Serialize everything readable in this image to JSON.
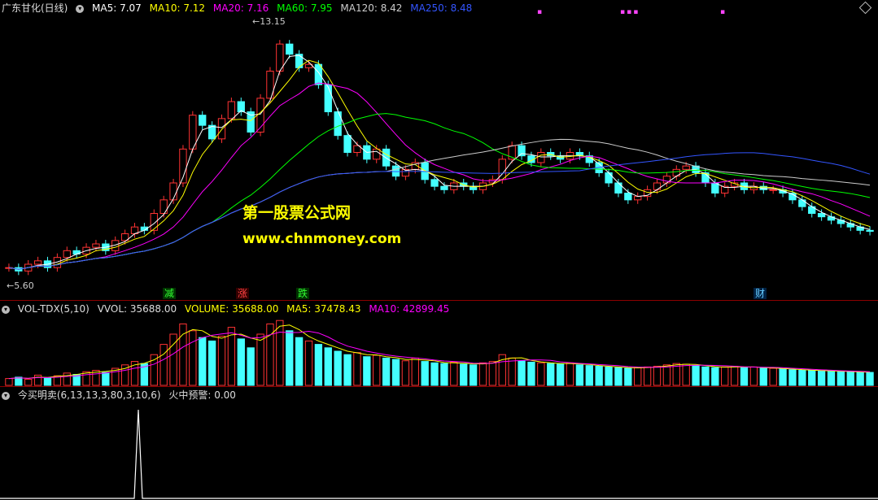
{
  "price_header": {
    "title": "广东甘化(日线)",
    "ma5": "MA5: 7.07",
    "ma10": "MA10: 7.12",
    "ma20": "MA20: 7.16",
    "ma60": "MA60: 7.95",
    "ma120": "MA120: 8.42",
    "ma250": "MA250: 8.48",
    "colors": {
      "ma5": "#ffffff",
      "ma10": "#ffff00",
      "ma20": "#ff00ff",
      "ma60": "#00ff00",
      "ma120": "#cccccc",
      "ma250": "#3355ff"
    }
  },
  "price_labels": {
    "high": "13.15",
    "low": "5.60"
  },
  "markers": [
    {
      "text": "减",
      "color": "#33ff33",
      "bg": "#003300"
    },
    {
      "text": "涨",
      "color": "#ff4444",
      "bg": "#330000"
    },
    {
      "text": "跌",
      "color": "#33ff33",
      "bg": "#003300"
    },
    {
      "text": "财",
      "color": "#66ccff",
      "bg": "#002244"
    }
  ],
  "watermark": {
    "line1": "第一股票公式网",
    "line2": "www.chnmoney.com"
  },
  "volume_header": {
    "name": "VOL-TDX(5,10)",
    "vvol": "VVOL: 35688.00",
    "volume": "VOLUME: 35688.00",
    "ma5": "MA5: 37478.43",
    "ma10": "MA10: 42899.45"
  },
  "indicator_header": {
    "name": "今买明卖(6,13,13,3,80,3,10,6)",
    "signal": "火中预警: 0.00"
  },
  "icons": {
    "collapse": "circle-icon",
    "menu": "diamond-icon"
  },
  "chart_data": {
    "type": "candlestick",
    "closes": [
      6.0,
      5.9,
      6.1,
      6.2,
      6.0,
      6.3,
      6.5,
      6.4,
      6.6,
      6.7,
      6.5,
      6.8,
      7.0,
      7.2,
      7.1,
      7.6,
      8.0,
      8.5,
      9.5,
      10.5,
      10.2,
      9.8,
      10.4,
      10.9,
      10.6,
      10.0,
      11.0,
      11.8,
      12.6,
      12.3,
      11.9,
      12.0,
      11.4,
      10.6,
      9.9,
      9.4,
      9.6,
      9.2,
      9.5,
      9.0,
      8.7,
      8.9,
      9.1,
      8.6,
      8.4,
      8.3,
      8.5,
      8.4,
      8.3,
      8.5,
      8.6,
      9.2,
      9.6,
      9.3,
      9.1,
      9.4,
      9.3,
      9.2,
      9.4,
      9.3,
      9.1,
      8.8,
      8.5,
      8.2,
      8.0,
      8.1,
      8.3,
      8.5,
      8.7,
      8.9,
      9.0,
      8.8,
      8.5,
      8.2,
      8.4,
      8.5,
      8.3,
      8.4,
      8.3,
      8.3,
      8.2,
      8.0,
      7.8,
      7.6,
      7.5,
      7.4,
      7.3,
      7.2,
      7.1,
      7.07
    ],
    "volume": [
      10,
      12,
      9,
      15,
      11,
      14,
      18,
      16,
      20,
      22,
      19,
      25,
      30,
      35,
      32,
      45,
      60,
      75,
      90,
      80,
      70,
      65,
      72,
      85,
      68,
      55,
      75,
      90,
      95,
      80,
      70,
      65,
      60,
      55,
      50,
      45,
      48,
      42,
      44,
      40,
      38,
      36,
      40,
      35,
      33,
      32,
      34,
      31,
      30,
      33,
      35,
      45,
      40,
      36,
      34,
      33,
      32,
      31,
      33,
      30,
      29,
      28,
      27,
      26,
      25,
      26,
      27,
      28,
      30,
      32,
      31,
      29,
      27,
      26,
      27,
      28,
      26,
      27,
      25,
      25,
      24,
      23,
      22,
      22,
      21,
      21,
      20,
      20,
      19,
      19
    ],
    "ma5_vol": "37478.43",
    "ma10_vol": "42899.45"
  }
}
